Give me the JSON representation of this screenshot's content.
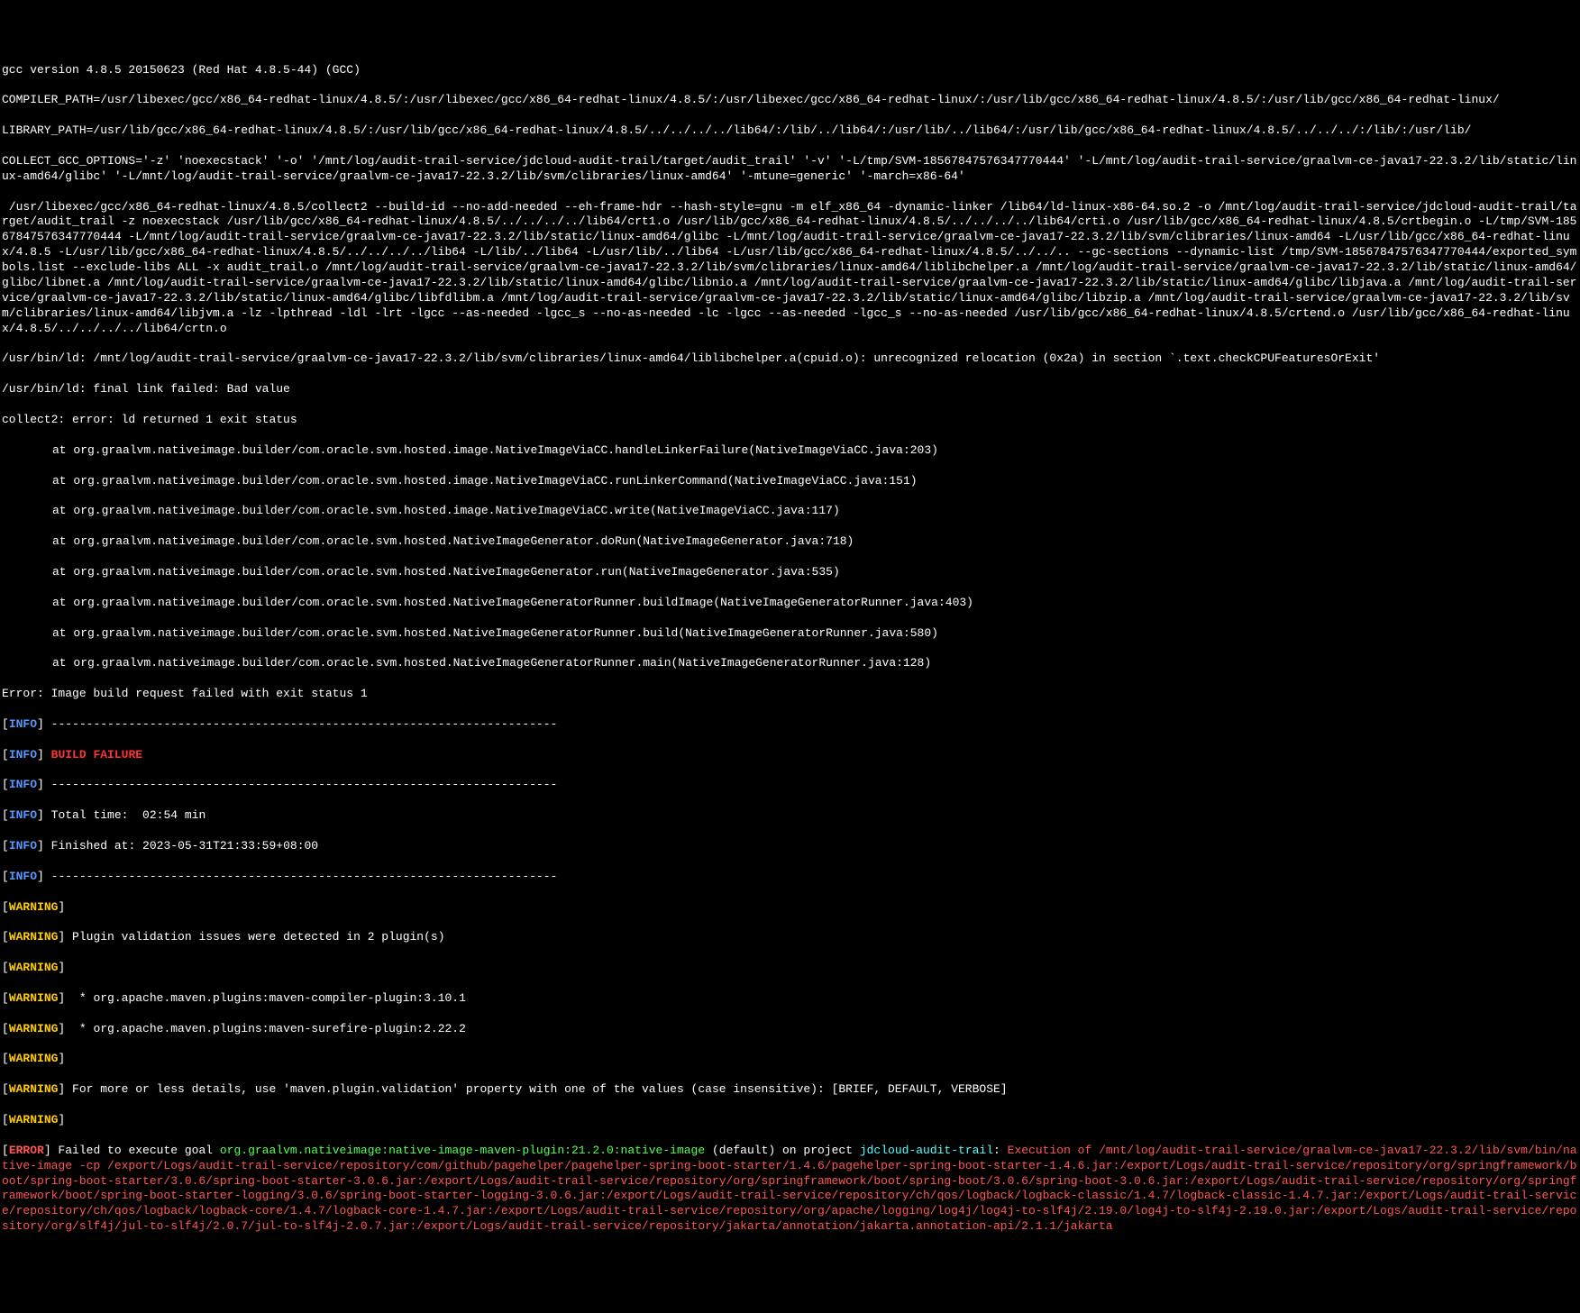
{
  "gcc_version": "gcc version 4.8.5 20150623 (Red Hat 4.8.5-44) (GCC)",
  "compiler_path": "COMPILER_PATH=/usr/libexec/gcc/x86_64-redhat-linux/4.8.5/:/usr/libexec/gcc/x86_64-redhat-linux/4.8.5/:/usr/libexec/gcc/x86_64-redhat-linux/:/usr/lib/gcc/x86_64-redhat-linux/4.8.5/:/usr/lib/gcc/x86_64-redhat-linux/",
  "library_path": "LIBRARY_PATH=/usr/lib/gcc/x86_64-redhat-linux/4.8.5/:/usr/lib/gcc/x86_64-redhat-linux/4.8.5/../../../../lib64/:/lib/../lib64/:/usr/lib/../lib64/:/usr/lib/gcc/x86_64-redhat-linux/4.8.5/../../../:/lib/:/usr/lib/",
  "collect_gcc_options": "COLLECT_GCC_OPTIONS='-z' 'noexecstack' '-o' '/mnt/log/audit-trail-service/jdcloud-audit-trail/target/audit_trail' '-v' '-L/tmp/SVM-18567847576347770444' '-L/mnt/log/audit-trail-service/graalvm-ce-java17-22.3.2/lib/static/linux-amd64/glibc' '-L/mnt/log/audit-trail-service/graalvm-ce-java17-22.3.2/lib/svm/clibraries/linux-amd64' '-mtune=generic' '-march=x86-64'",
  "collect2_line": " /usr/libexec/gcc/x86_64-redhat-linux/4.8.5/collect2 --build-id --no-add-needed --eh-frame-hdr --hash-style=gnu -m elf_x86_64 -dynamic-linker /lib64/ld-linux-x86-64.so.2 -o /mnt/log/audit-trail-service/jdcloud-audit-trail/target/audit_trail -z noexecstack /usr/lib/gcc/x86_64-redhat-linux/4.8.5/../../../../lib64/crt1.o /usr/lib/gcc/x86_64-redhat-linux/4.8.5/../../../../lib64/crti.o /usr/lib/gcc/x86_64-redhat-linux/4.8.5/crtbegin.o -L/tmp/SVM-18567847576347770444 -L/mnt/log/audit-trail-service/graalvm-ce-java17-22.3.2/lib/static/linux-amd64/glibc -L/mnt/log/audit-trail-service/graalvm-ce-java17-22.3.2/lib/svm/clibraries/linux-amd64 -L/usr/lib/gcc/x86_64-redhat-linux/4.8.5 -L/usr/lib/gcc/x86_64-redhat-linux/4.8.5/../../../../lib64 -L/lib/../lib64 -L/usr/lib/../lib64 -L/usr/lib/gcc/x86_64-redhat-linux/4.8.5/../../.. --gc-sections --dynamic-list /tmp/SVM-18567847576347770444/exported_symbols.list --exclude-libs ALL -x audit_trail.o /mnt/log/audit-trail-service/graalvm-ce-java17-22.3.2/lib/svm/clibraries/linux-amd64/liblibchelper.a /mnt/log/audit-trail-service/graalvm-ce-java17-22.3.2/lib/static/linux-amd64/glibc/libnet.a /mnt/log/audit-trail-service/graalvm-ce-java17-22.3.2/lib/static/linux-amd64/glibc/libnio.a /mnt/log/audit-trail-service/graalvm-ce-java17-22.3.2/lib/static/linux-amd64/glibc/libjava.a /mnt/log/audit-trail-service/graalvm-ce-java17-22.3.2/lib/static/linux-amd64/glibc/libfdlibm.a /mnt/log/audit-trail-service/graalvm-ce-java17-22.3.2/lib/static/linux-amd64/glibc/libzip.a /mnt/log/audit-trail-service/graalvm-ce-java17-22.3.2/lib/svm/clibraries/linux-amd64/libjvm.a -lz -lpthread -ldl -lrt -lgcc --as-needed -lgcc_s --no-as-needed -lc -lgcc --as-needed -lgcc_s --no-as-needed /usr/lib/gcc/x86_64-redhat-linux/4.8.5/crtend.o /usr/lib/gcc/x86_64-redhat-linux/4.8.5/../../../../lib64/crtn.o",
  "ld_error1": "/usr/bin/ld: /mnt/log/audit-trail-service/graalvm-ce-java17-22.3.2/lib/svm/clibraries/linux-amd64/liblibchelper.a(cpuid.o): unrecognized relocation (0x2a) in section `.text.checkCPUFeaturesOrExit'",
  "ld_error2": "/usr/bin/ld: final link failed: Bad value",
  "collect2_error": "collect2: error: ld returned 1 exit status",
  "stack": [
    "at org.graalvm.nativeimage.builder/com.oracle.svm.hosted.image.NativeImageViaCC.handleLinkerFailure(NativeImageViaCC.java:203)",
    "at org.graalvm.nativeimage.builder/com.oracle.svm.hosted.image.NativeImageViaCC.runLinkerCommand(NativeImageViaCC.java:151)",
    "at org.graalvm.nativeimage.builder/com.oracle.svm.hosted.image.NativeImageViaCC.write(NativeImageViaCC.java:117)",
    "at org.graalvm.nativeimage.builder/com.oracle.svm.hosted.NativeImageGenerator.doRun(NativeImageGenerator.java:718)",
    "at org.graalvm.nativeimage.builder/com.oracle.svm.hosted.NativeImageGenerator.run(NativeImageGenerator.java:535)",
    "at org.graalvm.nativeimage.builder/com.oracle.svm.hosted.NativeImageGeneratorRunner.buildImage(NativeImageGeneratorRunner.java:403)",
    "at org.graalvm.nativeimage.builder/com.oracle.svm.hosted.NativeImageGeneratorRunner.build(NativeImageGeneratorRunner.java:580)",
    "at org.graalvm.nativeimage.builder/com.oracle.svm.hosted.NativeImageGeneratorRunner.main(NativeImageGeneratorRunner.java:128)"
  ],
  "error_build": "Error: Image build request failed with exit status 1",
  "separator": " ------------------------------------------------------------------------",
  "build_failure": " BUILD FAILURE",
  "total_time": " Total time:  02:54 min",
  "finished_at": " Finished at: 2023-05-31T21:33:59+08:00",
  "warnings": {
    "empty": " ",
    "plugin_validation": " Plugin validation issues were detected in 2 plugin(s)",
    "compiler_plugin": "  * org.apache.maven.plugins:maven-compiler-plugin:3.10.1",
    "surefire_plugin": "  * org.apache.maven.plugins:maven-surefire-plugin:2.22.2",
    "more_details": " For more or less details, use 'maven.plugin.validation' property with one of the values (case insensitive): [BRIEF, DEFAULT, VERBOSE]"
  },
  "error": {
    "prefix": " Failed to execute goal ",
    "goal": "org.graalvm.nativeimage:native-image-maven-plugin:21.2.0:native-image",
    "default": " (default)",
    "on_project": " on project ",
    "project_name": "jdcloud-audit-trail",
    "colon": ": ",
    "execution": "Execution of /mnt/log/audit-trail-service/graalvm-ce-java17-22.3.2/lib/svm/bin/native-image -cp /export/Logs/audit-trail-service/repository/com/github/pagehelper/pagehelper-spring-boot-starter/1.4.6/pagehelper-spring-boot-starter-1.4.6.jar:/export/Logs/audit-trail-service/repository/org/springframework/boot/spring-boot-starter/3.0.6/spring-boot-starter-3.0.6.jar:/export/Logs/audit-trail-service/repository/org/springframework/boot/spring-boot/3.0.6/spring-boot-3.0.6.jar:/export/Logs/audit-trail-service/repository/org/springframework/boot/spring-boot-starter-logging/3.0.6/spring-boot-starter-logging-3.0.6.jar:/export/Logs/audit-trail-service/repository/ch/qos/logback/logback-classic/1.4.7/logback-classic-1.4.7.jar:/export/Logs/audit-trail-service/repository/ch/qos/logback/logback-core/1.4.7/logback-core-1.4.7.jar:/export/Logs/audit-trail-service/repository/org/apache/logging/log4j/log4j-to-slf4j/2.19.0/log4j-to-slf4j-2.19.0.jar:/export/Logs/audit-trail-service/repository/org/slf4j/jul-to-slf4j/2.0.7/jul-to-slf4j-2.0.7.jar:/export/Logs/audit-trail-service/repository/jakarta/annotation/jakarta.annotation-api/2.1.1/jakarta"
  },
  "labels": {
    "info": "INFO",
    "warning": "WARNING",
    "error": "ERROR"
  }
}
